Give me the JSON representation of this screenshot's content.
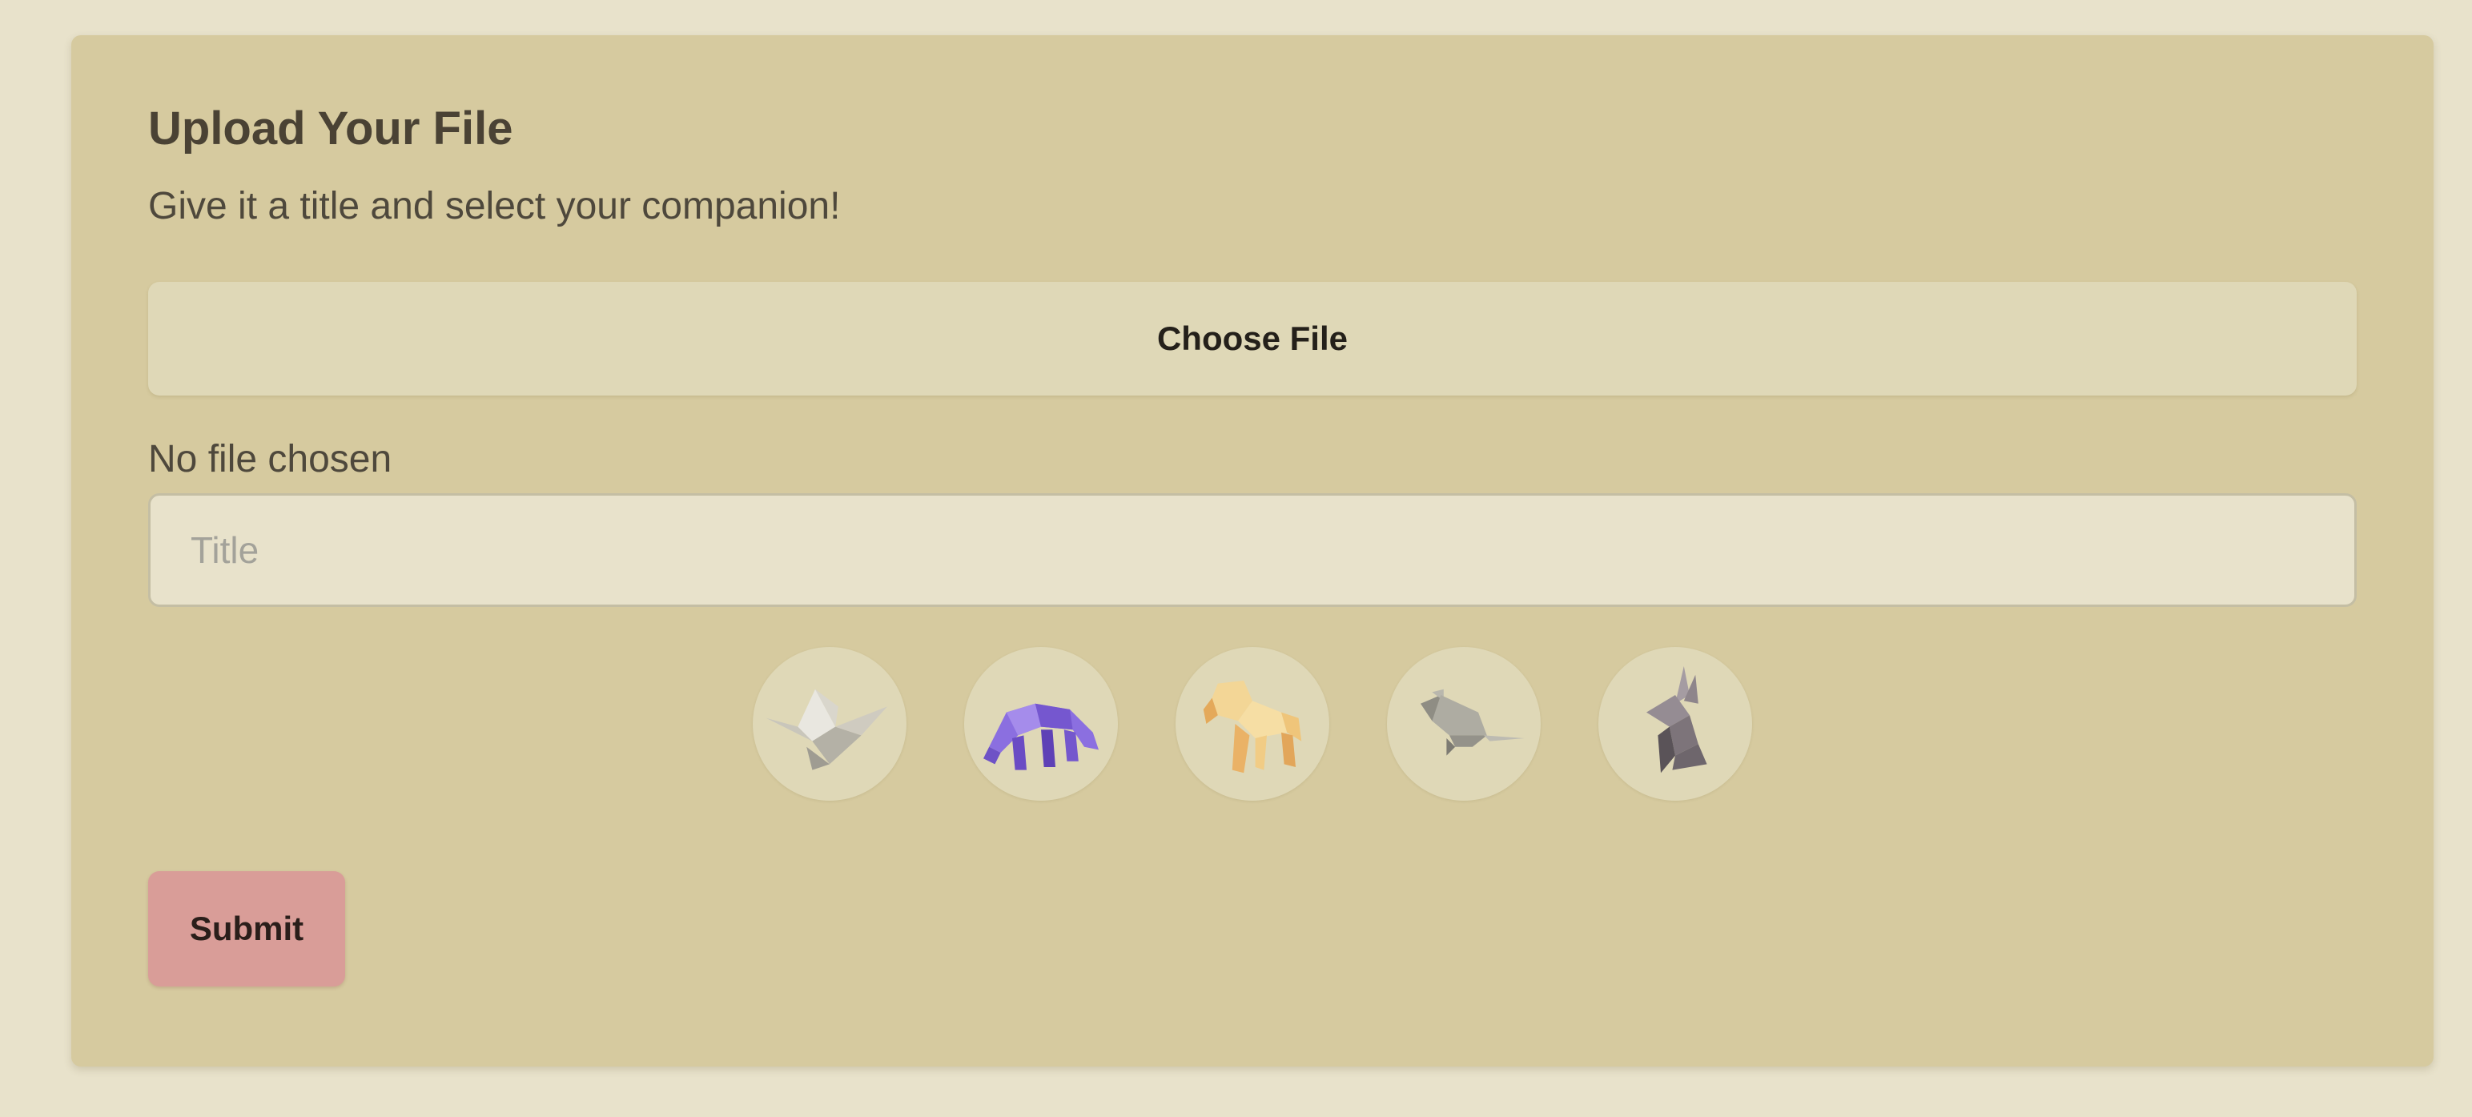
{
  "form": {
    "title": "Upload Your File",
    "subtitle": "Give it a title and select your companion!",
    "choose_file_label": "Choose File",
    "file_status": "No file chosen",
    "title_input": {
      "value": "",
      "placeholder": "Title"
    },
    "companions": [
      {
        "icon": "origami-crane-icon",
        "color": "#d3d0c6"
      },
      {
        "icon": "origami-elephant-icon",
        "color": "#8669d8"
      },
      {
        "icon": "origami-dog-icon",
        "color": "#eec97c"
      },
      {
        "icon": "origami-mouse-icon",
        "color": "#a7a59b"
      },
      {
        "icon": "origami-rabbit-icon",
        "color": "#8b8288"
      }
    ],
    "submit_label": "Submit"
  },
  "colors": {
    "page_background": "#e8e2cb",
    "card_background": "#d6ca9f",
    "file_button_background": "#dfd8b7",
    "submit_button_background": "#d99d98"
  }
}
